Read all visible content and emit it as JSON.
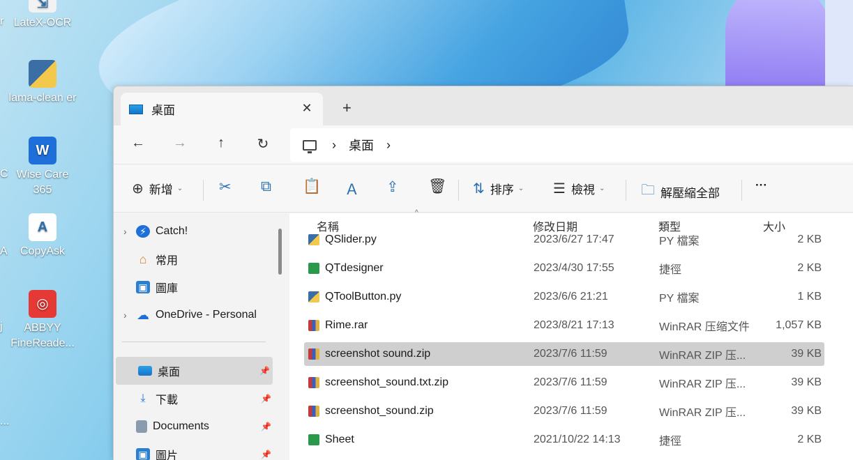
{
  "desktop": {
    "icons": [
      {
        "label": "LateX-OCR",
        "icon": "latexocr-icon"
      },
      {
        "label": "lama-clean er",
        "icon": "python-shortcut-icon"
      },
      {
        "label": "Wise Care 365",
        "icon": "wisecare-icon"
      },
      {
        "label": "CopyAsk",
        "icon": "copyask-icon"
      },
      {
        "label": "ABBYY FineReade...",
        "icon": "abbyy-icon"
      }
    ],
    "partial_labels": [
      "r",
      "C",
      "A",
      "j",
      "..."
    ]
  },
  "window": {
    "tab": {
      "title": "桌面",
      "close": "✕"
    },
    "new_tab": "+",
    "nav": {
      "back": "←",
      "forward": "→",
      "up": "↑",
      "refresh": "↻"
    },
    "address": {
      "root_icon": "monitor-icon",
      "segment": "桌面",
      "chevron": "›"
    },
    "commands": {
      "new": "新增",
      "sort": "排序",
      "view": "檢視",
      "extract_all": "解壓縮全部",
      "more": "···"
    },
    "sidebar": {
      "items": [
        {
          "label": "Catch!",
          "icon": "catch-icon",
          "expandable": true
        },
        {
          "label": "常用",
          "icon": "home-icon",
          "expandable": false
        },
        {
          "label": "圖庫",
          "icon": "gallery-icon",
          "expandable": false
        },
        {
          "label": "OneDrive - Personal",
          "icon": "onedrive-icon",
          "expandable": true
        }
      ],
      "pinned": [
        {
          "label": "桌面",
          "icon": "desktop-folder-icon"
        },
        {
          "label": "下載",
          "icon": "download-icon"
        },
        {
          "label": "Documents",
          "icon": "documents-icon"
        },
        {
          "label": "圖片",
          "icon": "pictures-icon"
        }
      ]
    },
    "columns": {
      "name": "名稱",
      "date": "修改日期",
      "type": "類型",
      "size": "大小"
    },
    "files": [
      {
        "name": "QSlider.py",
        "date": "2023/6/27 17:47",
        "type": "PY 檔案",
        "size": "2 KB",
        "kind": "py"
      },
      {
        "name": "QTdesigner",
        "date": "2023/4/30 17:55",
        "type": "捷徑",
        "size": "2 KB",
        "kind": "lnk"
      },
      {
        "name": "QToolButton.py",
        "date": "2023/6/6 21:21",
        "type": "PY 檔案",
        "size": "1 KB",
        "kind": "py"
      },
      {
        "name": "Rime.rar",
        "date": "2023/8/21 17:13",
        "type": "WinRAR 压缩文件",
        "size": "1,057 KB",
        "kind": "rar"
      },
      {
        "name": "screenshot sound.zip",
        "date": "2023/7/6 11:59",
        "type": "WinRAR ZIP 压...",
        "size": "39 KB",
        "kind": "rar"
      },
      {
        "name": "screenshot_sound.txt.zip",
        "date": "2023/7/6 11:59",
        "type": "WinRAR ZIP 压...",
        "size": "39 KB",
        "kind": "rar"
      },
      {
        "name": "screenshot_sound.zip",
        "date": "2023/7/6 11:59",
        "type": "WinRAR ZIP 压...",
        "size": "39 KB",
        "kind": "rar"
      },
      {
        "name": "Sheet",
        "date": "2021/10/22 14:13",
        "type": "捷徑",
        "size": "2 KB",
        "kind": "lnk"
      }
    ]
  }
}
